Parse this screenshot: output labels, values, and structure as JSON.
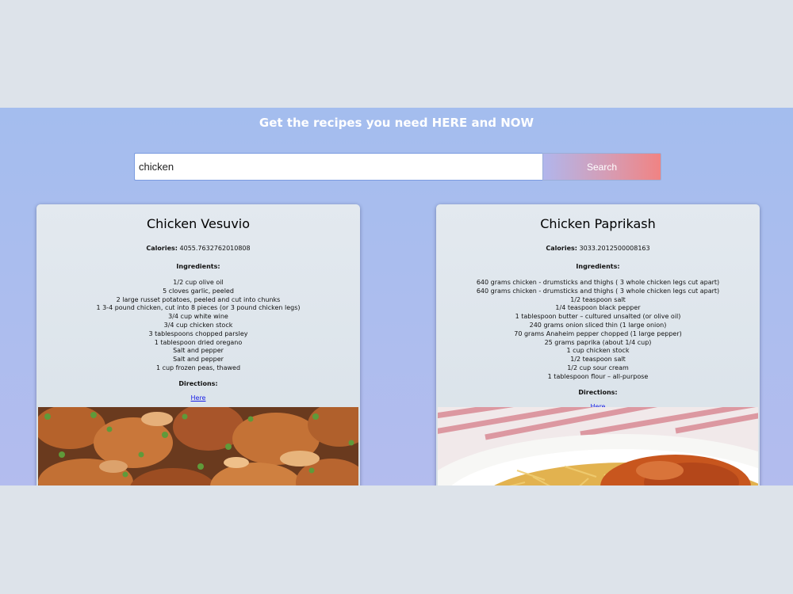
{
  "header": {
    "title": "Get the recipes you need HERE and NOW"
  },
  "search": {
    "value": "chicken",
    "button_label": "Search"
  },
  "recipes": [
    {
      "title": "Chicken Vesuvio",
      "calories_label": "Calories:",
      "calories": "4055.7632762010808",
      "ingredients_label": "Ingredients:",
      "ingredients": [
        "1/2 cup olive oil",
        "5 cloves garlic, peeled",
        "2 large russet potatoes, peeled and cut into chunks",
        "1 3-4 pound chicken, cut into 8 pieces (or 3 pound chicken legs)",
        "3/4 cup white wine",
        "3/4 cup chicken stock",
        "3 tablespoons chopped parsley",
        "1 tablespoon dried oregano",
        "Salt and pepper",
        "Salt and pepper",
        "1 cup frozen peas, thawed"
      ],
      "directions_label": "Directions:",
      "directions_link": "Here"
    },
    {
      "title": "Chicken Paprikash",
      "calories_label": "Calories:",
      "calories": "3033.2012500008163",
      "ingredients_label": "Ingredients:",
      "ingredients": [
        "640 grams chicken - drumsticks and thighs ( 3 whole chicken legs cut apart)",
        "640 grams chicken - drumsticks and thighs ( 3 whole chicken legs cut apart)",
        "1/2 teaspoon salt",
        "1/4 teaspoon black pepper",
        "1 tablespoon butter – cultured unsalted (or olive oil)",
        "240 grams onion sliced thin (1 large onion)",
        "70 grams Anaheim pepper chopped (1 large pepper)",
        "25 grams paprika (about 1/4 cup)",
        "1 cup chicken stock",
        "1/2 teaspoon salt",
        "1/2 cup sour cream",
        "1 tablespoon flour – all-purpose"
      ],
      "directions_label": "Directions:",
      "directions_link": "Here"
    }
  ],
  "colors": {
    "banner_top": "#a4bdee",
    "banner_bottom": "#b3bcee",
    "button_left": "#b1b6ec",
    "button_right": "#f08383",
    "link": "#1a20e6"
  }
}
